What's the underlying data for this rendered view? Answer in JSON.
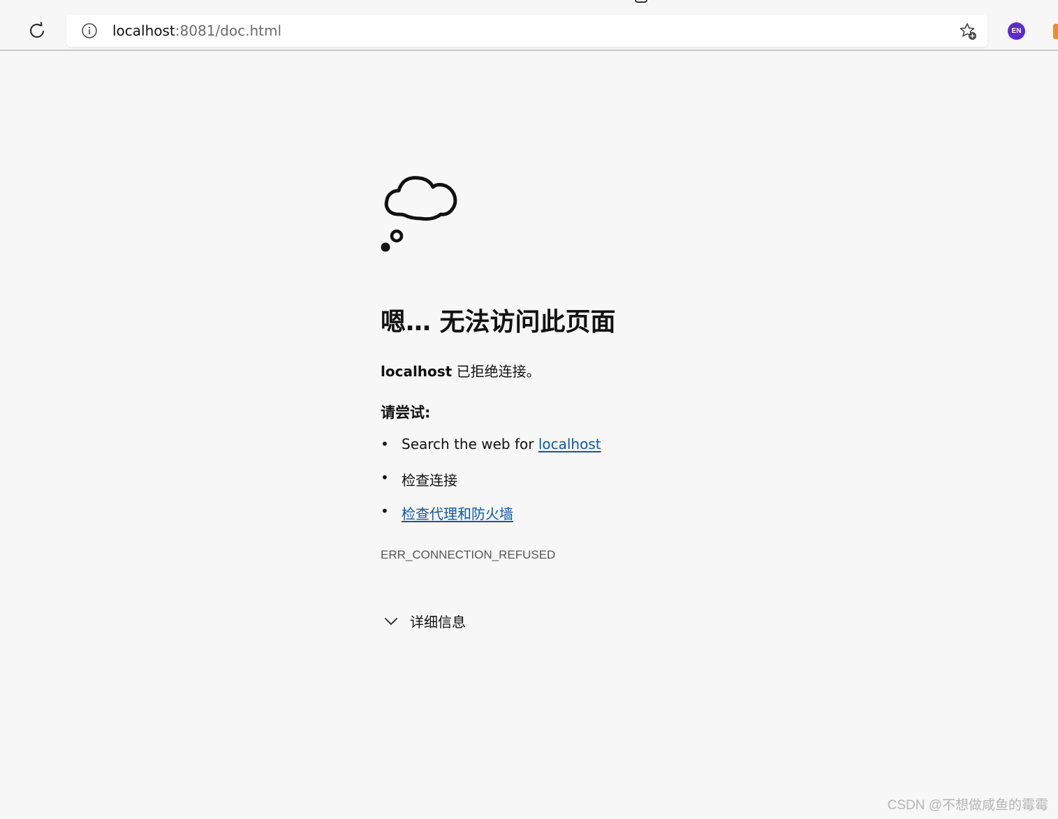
{
  "browser": {
    "url_host": "localhost",
    "url_rest": ":8081/doc.html",
    "profile_badge": "EN"
  },
  "error_page": {
    "headline": "嗯… 无法访问此页面",
    "host_bold": "localhost",
    "refused_text": " 已拒绝连接。",
    "try_title": "请尝试:",
    "suggestions": {
      "search_prefix": "Search the web for ",
      "search_link": "localhost",
      "check_connection": "检查连接",
      "check_proxy_link": "检查代理和防火墙"
    },
    "error_code": "ERR_CONNECTION_REFUSED",
    "details_label": "详细信息"
  },
  "watermark": "CSDN @不想做咸鱼的霉霉",
  "colors": {
    "link": "#0a58a8",
    "profile_badge_bg": "#5b2ccf",
    "page_bg": "#f7f7f7"
  },
  "icons": [
    "refresh-icon",
    "info-icon",
    "favorite-add-icon",
    "thought-cloud-icon",
    "chevron-down-icon"
  ]
}
